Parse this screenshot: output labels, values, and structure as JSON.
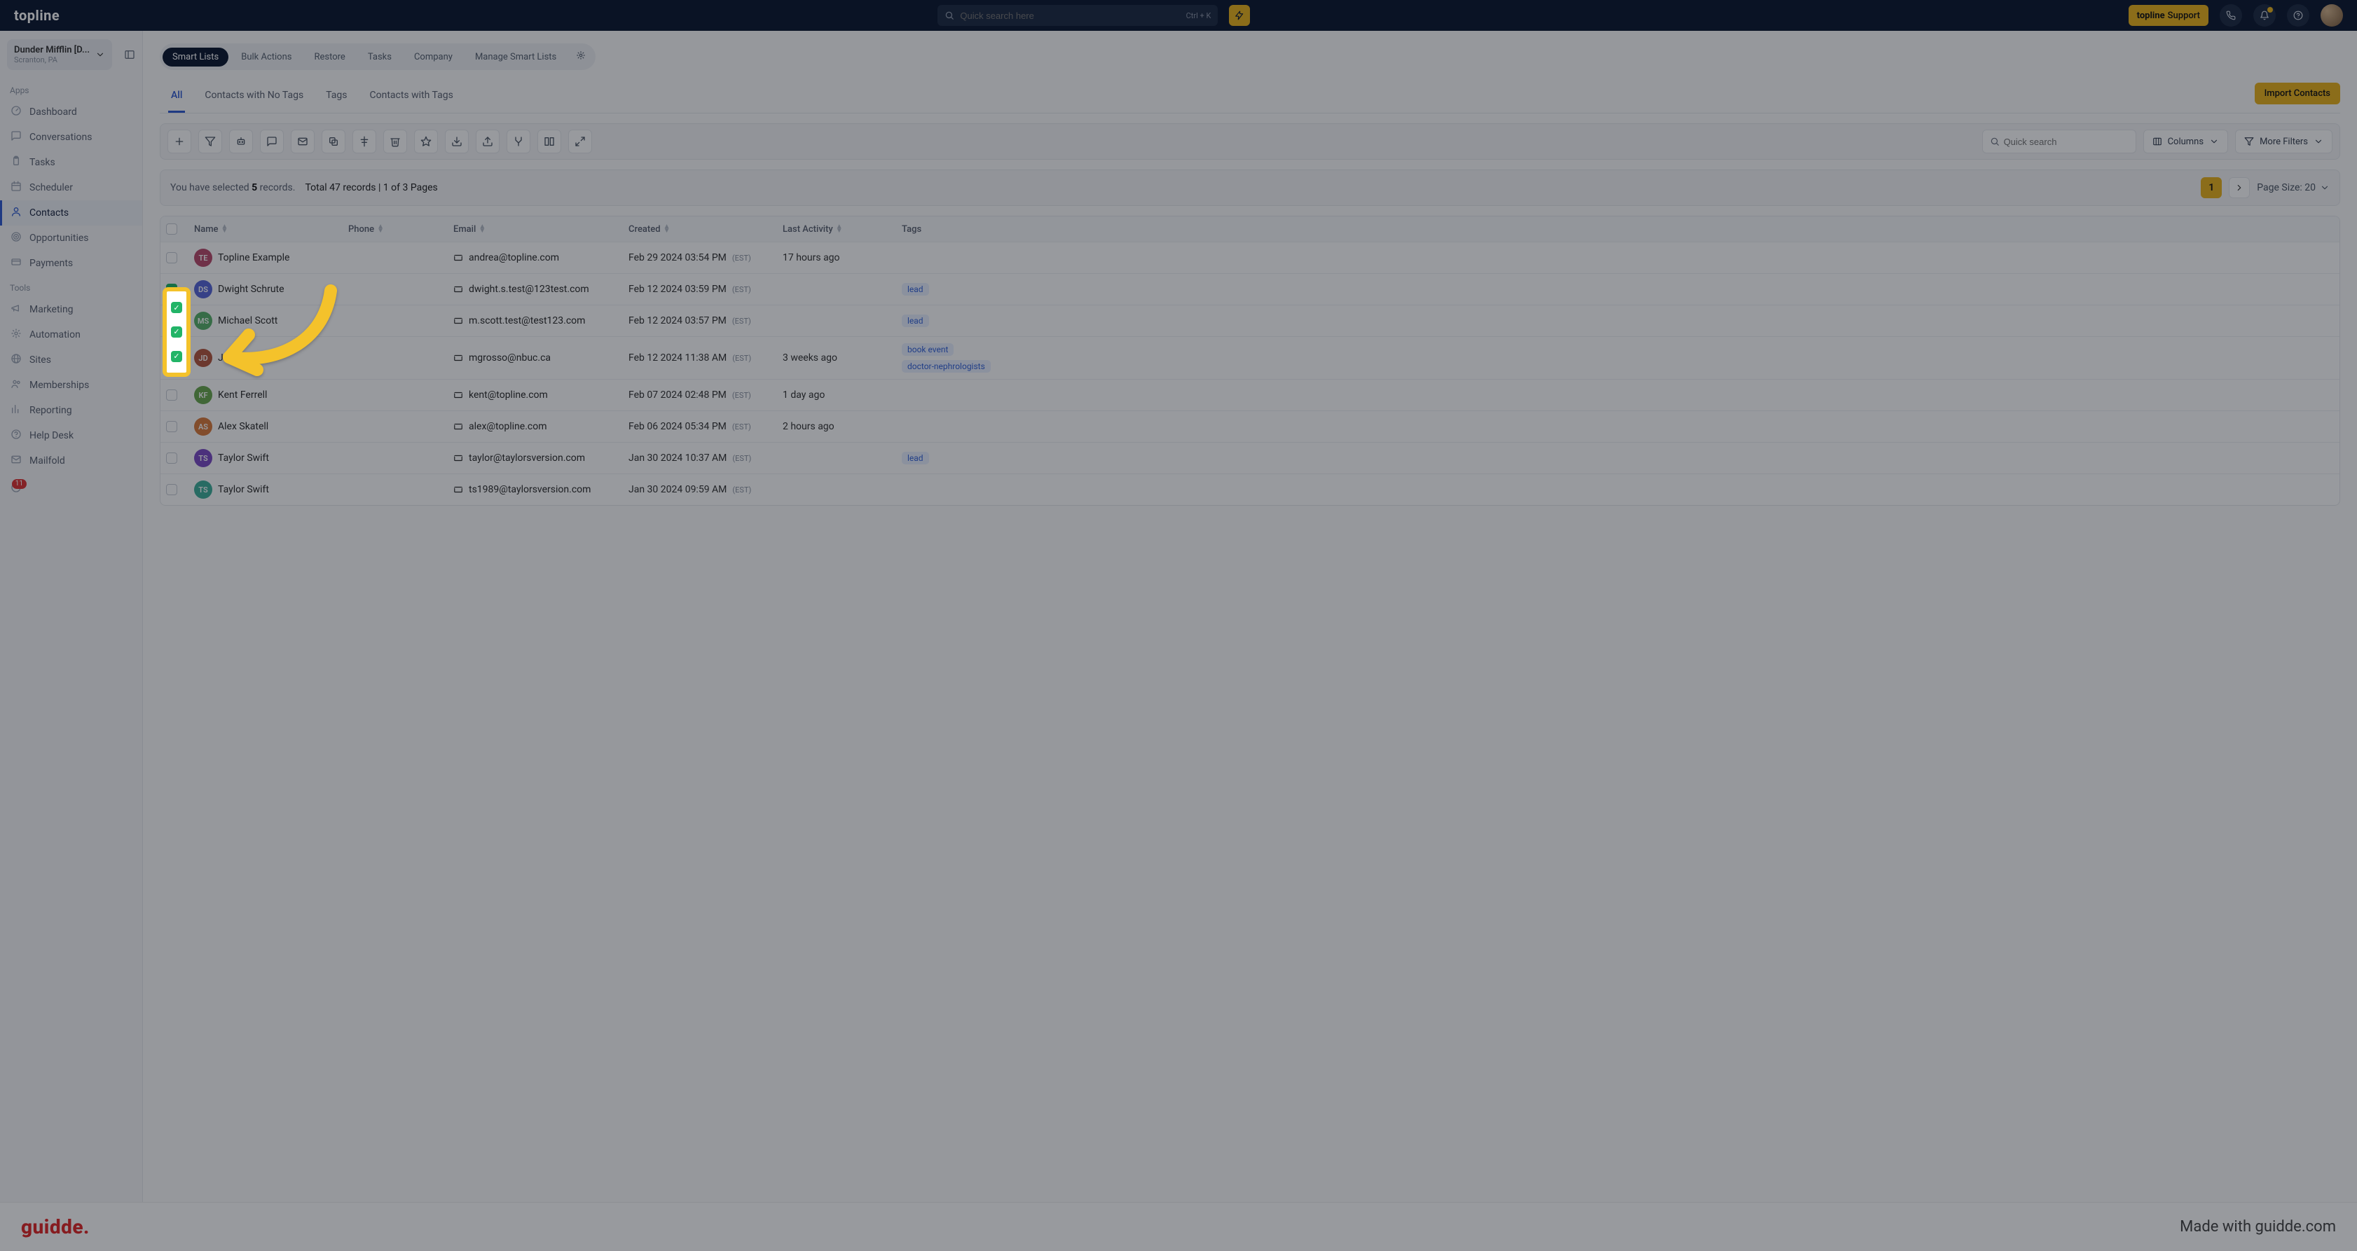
{
  "header": {
    "logo": "topline",
    "search_placeholder": "Quick search here",
    "shortcut": "Ctrl + K",
    "support_brand": "topline",
    "support_word": "Support"
  },
  "workspace": {
    "name": "Dunder Mifflin [D...",
    "location": "Scranton, PA"
  },
  "sidebar": {
    "apps_label": "Apps",
    "tools_label": "Tools",
    "apps": [
      {
        "label": "Dashboard",
        "icon": "gauge"
      },
      {
        "label": "Conversations",
        "icon": "chat"
      },
      {
        "label": "Tasks",
        "icon": "clipboard"
      },
      {
        "label": "Scheduler",
        "icon": "calendar"
      },
      {
        "label": "Contacts",
        "icon": "user",
        "active": true
      },
      {
        "label": "Opportunities",
        "icon": "target"
      },
      {
        "label": "Payments",
        "icon": "card"
      }
    ],
    "tools": [
      {
        "label": "Marketing",
        "icon": "megaphone"
      },
      {
        "label": "Automation",
        "icon": "gear"
      },
      {
        "label": "Sites",
        "icon": "globe"
      },
      {
        "label": "Memberships",
        "icon": "users"
      },
      {
        "label": "Reporting",
        "icon": "chart"
      },
      {
        "label": "Help Desk",
        "icon": "help"
      },
      {
        "label": "Mailfold",
        "icon": "mail"
      }
    ],
    "badge_count": "11"
  },
  "tabs": {
    "pills": [
      "Smart Lists",
      "Bulk Actions",
      "Restore",
      "Tasks",
      "Company",
      "Manage Smart Lists"
    ],
    "subtabs": [
      "All",
      "Contacts with No Tags",
      "Tags",
      "Contacts with Tags"
    ],
    "import_label": "Import Contacts"
  },
  "toolbar": {
    "quick_search_placeholder": "Quick search",
    "columns_label": "Columns",
    "filters_label": "More Filters"
  },
  "selection": {
    "prefix": "You have selected ",
    "count": "5",
    "suffix": " records.",
    "total_text": "Total 47 records | 1 of 3 Pages",
    "page_current": "1",
    "page_size_label": "Page Size: 20"
  },
  "columns": [
    "Name",
    "Phone",
    "Email",
    "Created",
    "Last Activity",
    "Tags"
  ],
  "rows": [
    {
      "checked": false,
      "initials": "TE",
      "color": "#b84a6b",
      "name": "Topline Example",
      "phone": "",
      "email": "andrea@topline.com",
      "created": "Feb 29 2024 03:54 PM",
      "tz": "(EST)",
      "activity": "17 hours ago",
      "tags": []
    },
    {
      "checked": true,
      "initials": "DS",
      "color": "#5766d8",
      "name": "Dwight Schrute",
      "phone": "",
      "email": "dwight.s.test@123test.com",
      "created": "Feb 12 2024 03:59 PM",
      "tz": "(EST)",
      "activity": "",
      "tags": [
        "lead"
      ]
    },
    {
      "checked": true,
      "initials": "MS",
      "color": "#58b06a",
      "name": "Michael Scott",
      "phone": "",
      "email": "m.scott.test@test123.com",
      "created": "Feb 12 2024 03:57 PM",
      "tz": "(EST)",
      "activity": "",
      "tags": [
        "lead"
      ]
    },
    {
      "checked": true,
      "initials": "JD",
      "color": "#b4563f",
      "name": "Jane Doe",
      "phone": "",
      "email": "mgrosso@nbuc.ca",
      "created": "Feb 12 2024 11:38 AM",
      "tz": "(EST)",
      "activity": "3 weeks ago",
      "tags": [
        "book event",
        "doctor-nephrologists"
      ]
    },
    {
      "checked": false,
      "initials": "KF",
      "color": "#6aa84f",
      "name": "Kent Ferrell",
      "phone": "",
      "email": "kent@topline.com",
      "created": "Feb 07 2024 02:48 PM",
      "tz": "(EST)",
      "activity": "1 day ago",
      "tags": []
    },
    {
      "checked": false,
      "initials": "AS",
      "color": "#d97a3b",
      "name": "Alex Skatell",
      "phone": "",
      "email": "alex@topline.com",
      "created": "Feb 06 2024 05:34 PM",
      "tz": "(EST)",
      "activity": "2 hours ago",
      "tags": []
    },
    {
      "checked": false,
      "initials": "TS",
      "color": "#7a4bc4",
      "name": "Taylor Swift",
      "phone": "",
      "email": "taylor@taylorsversion.com",
      "created": "Jan 30 2024 10:37 AM",
      "tz": "(EST)",
      "activity": "",
      "tags": [
        "lead"
      ]
    },
    {
      "checked": false,
      "initials": "TS",
      "color": "#3fae9a",
      "name": "Taylor Swift",
      "phone": "",
      "email": "ts1989@taylorsversion.com",
      "created": "Jan 30 2024 09:59 AM",
      "tz": "(EST)",
      "activity": "",
      "tags": []
    }
  ],
  "footer": {
    "brand": "guidde.",
    "madewith": "Made with guidde.com"
  }
}
